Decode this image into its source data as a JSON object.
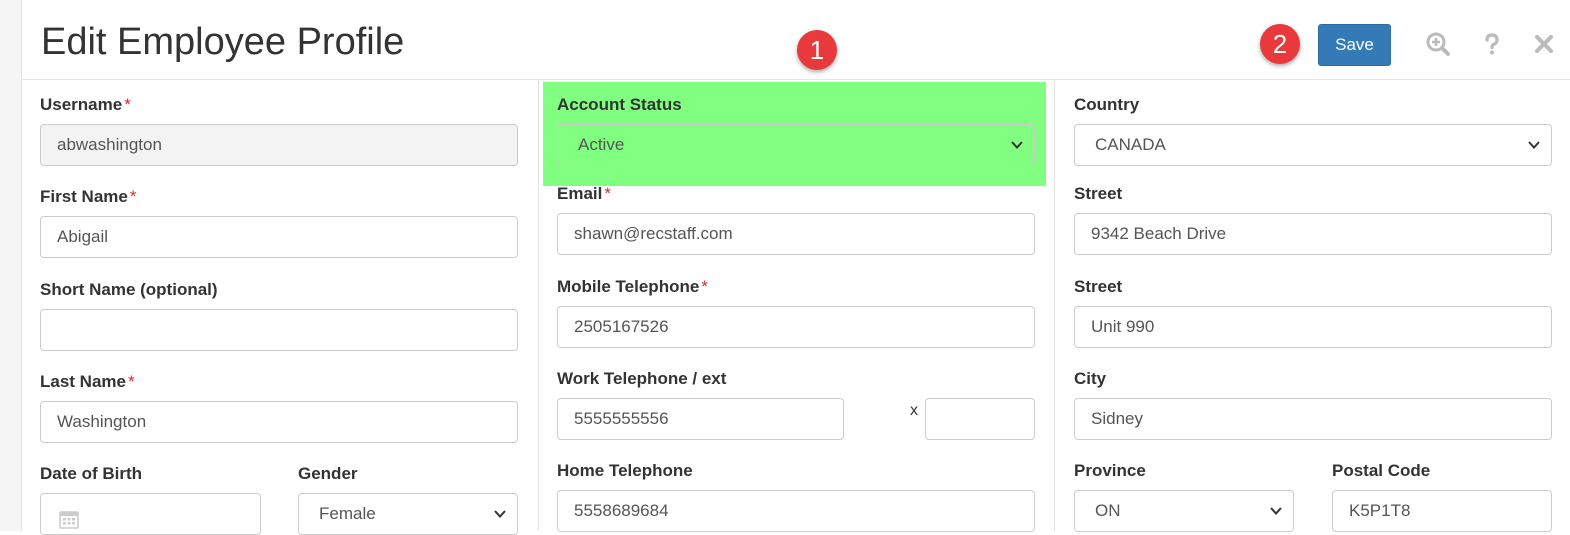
{
  "header": {
    "title": "Edit Employee Profile",
    "badge_1": "1",
    "badge_2": "2",
    "save_label": "Save",
    "icons": [
      "zoom-in-icon",
      "help-icon",
      "close-icon"
    ]
  },
  "colors": {
    "primary": "#337ab7",
    "badge": "#e8393c",
    "highlight": "#80ff80",
    "required": "#c9302c"
  },
  "form": {
    "username": {
      "label": "Username",
      "required": "*",
      "value": "abwashington"
    },
    "first_name": {
      "label": "First Name",
      "required": "*",
      "value": "Abigail"
    },
    "short_name": {
      "label": "Short Name (optional)",
      "value": ""
    },
    "last_name": {
      "label": "Last Name",
      "required": "*",
      "value": "Washington"
    },
    "date_of_birth": {
      "label": "Date of Birth",
      "value": ""
    },
    "gender": {
      "label": "Gender",
      "value": "Female"
    },
    "account_status": {
      "label": "Account Status",
      "value": "Active"
    },
    "email": {
      "label": "Email",
      "required": "*",
      "value": "shawn@recstaff.com"
    },
    "mobile_telephone": {
      "label": "Mobile Telephone",
      "required": "*",
      "value": "2505167526"
    },
    "work_telephone": {
      "label": "Work Telephone / ext",
      "value": "5555555556",
      "ext_separator": "x",
      "ext_value": ""
    },
    "home_telephone": {
      "label": "Home Telephone",
      "value": "5558689684"
    },
    "country": {
      "label": "Country",
      "value": "CANADA"
    },
    "street_1": {
      "label": "Street",
      "value": "9342 Beach Drive"
    },
    "street_2": {
      "label": "Street",
      "value": "Unit 990"
    },
    "city": {
      "label": "City",
      "value": "Sidney"
    },
    "province": {
      "label": "Province",
      "value": "ON"
    },
    "postal_code": {
      "label": "Postal Code",
      "value": "K5P1T8"
    }
  }
}
